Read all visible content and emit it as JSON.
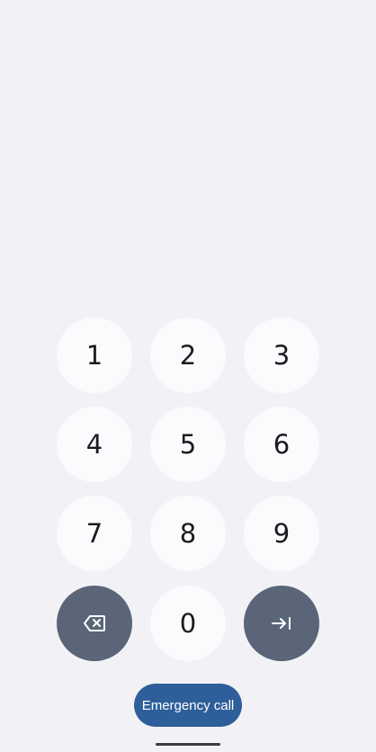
{
  "keypad": {
    "digits": [
      "1",
      "2",
      "3",
      "4",
      "5",
      "6",
      "7",
      "8",
      "9",
      "0"
    ],
    "backspace_icon": "backspace-icon",
    "enter_icon": "enter-arrow-icon"
  },
  "emergency": {
    "label": "Emergency call"
  },
  "colors": {
    "background": "#f2f2f6",
    "key_bg": "#fbfbfd",
    "dark_key_bg": "#5a6678",
    "emergency_bg": "#2e5f9a"
  }
}
